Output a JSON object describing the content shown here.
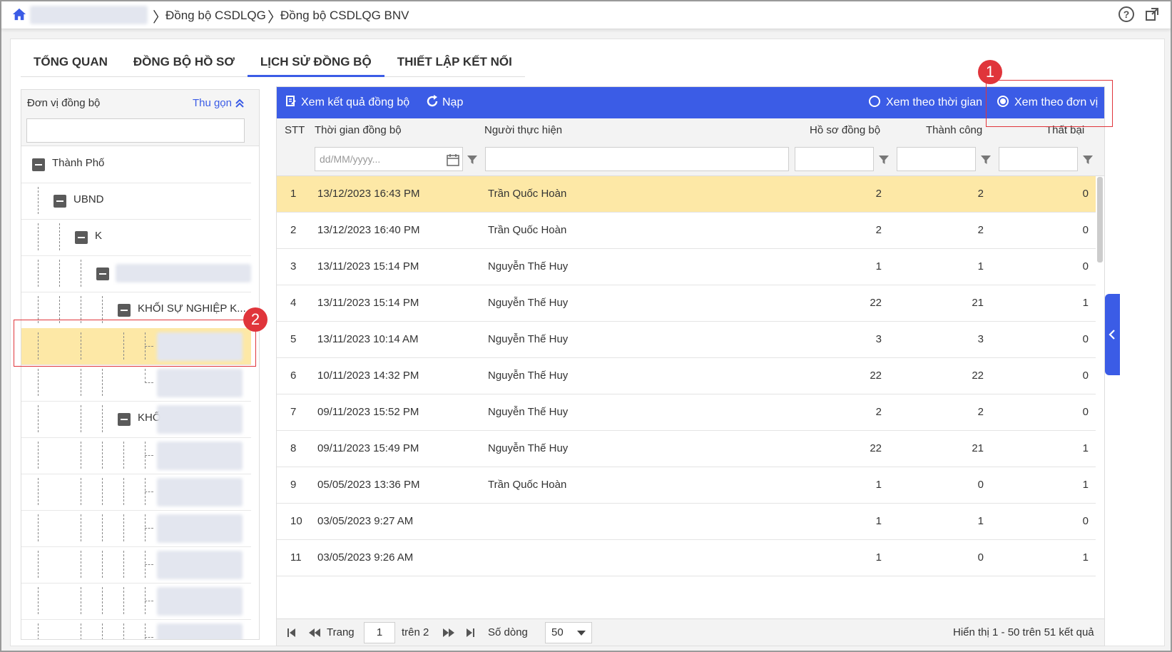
{
  "breadcrumb": {
    "items": [
      "Đồng bộ CSDLQG",
      "Đồng bộ CSDLQG BNV"
    ]
  },
  "help_glyph": "?",
  "tabs": [
    {
      "label": "TỔNG QUAN"
    },
    {
      "label": "ĐỒNG BỘ HỒ SƠ"
    },
    {
      "label": "LỊCH SỬ ĐỒNG BỘ",
      "active": true
    },
    {
      "label": "THIẾT LẬP KẾT NỐI"
    }
  ],
  "left_panel": {
    "title": "Đơn vị đồng bộ",
    "collapse_label": "Thu gọn",
    "tree": [
      "Thành Phố",
      "UBND",
      "K",
      "",
      "KHỐI SỰ NGHIỆP K...",
      "",
      "",
      "KHỐ",
      "",
      "",
      "",
      "",
      ""
    ]
  },
  "toolbar": {
    "view_result_label": "Xem kết quả đồng bộ",
    "reload_label": "Nạp",
    "view_by_time_label": "Xem theo thời gian",
    "view_by_unit_label": "Xem theo đơn vị",
    "selected_view": "Xem theo đơn vị"
  },
  "table": {
    "columns": [
      "STT",
      "Thời gian đồng bộ",
      "Người thực hiện",
      "Hồ sơ đồng bộ",
      "Thành công",
      "Thất bại"
    ],
    "date_placeholder": "dd/MM/yyyy...",
    "rows": [
      {
        "stt": "1",
        "time": "13/12/2023 16:43 PM",
        "user": "Trần Quốc Hoàn",
        "synced": "2",
        "success": "2",
        "failed": "0"
      },
      {
        "stt": "2",
        "time": "13/12/2023 16:40 PM",
        "user": "Trần Quốc Hoàn",
        "synced": "2",
        "success": "2",
        "failed": "0"
      },
      {
        "stt": "3",
        "time": "13/11/2023 15:14 PM",
        "user": "Nguyễn Thế Huy",
        "synced": "1",
        "success": "1",
        "failed": "0"
      },
      {
        "stt": "4",
        "time": "13/11/2023 15:14 PM",
        "user": "Nguyễn Thế Huy",
        "synced": "22",
        "success": "21",
        "failed": "1"
      },
      {
        "stt": "5",
        "time": "13/11/2023 10:14 AM",
        "user": "Nguyễn Thế Huy",
        "synced": "3",
        "success": "3",
        "failed": "0"
      },
      {
        "stt": "6",
        "time": "10/11/2023 14:32 PM",
        "user": "Nguyễn Thế Huy",
        "synced": "22",
        "success": "22",
        "failed": "0"
      },
      {
        "stt": "7",
        "time": "09/11/2023 15:52 PM",
        "user": "Nguyễn Thế Huy",
        "synced": "2",
        "success": "2",
        "failed": "0"
      },
      {
        "stt": "8",
        "time": "09/11/2023 15:49 PM",
        "user": "Nguyễn Thế Huy",
        "synced": "22",
        "success": "21",
        "failed": "1"
      },
      {
        "stt": "9",
        "time": "05/05/2023 13:36 PM",
        "user": "Trần Quốc Hoàn",
        "synced": "1",
        "success": "0",
        "failed": "1"
      },
      {
        "stt": "10",
        "time": "03/05/2023 9:27 AM",
        "user": "",
        "synced": "1",
        "success": "1",
        "failed": "0"
      },
      {
        "stt": "11",
        "time": "03/05/2023 9:26 AM",
        "user": "",
        "synced": "1",
        "success": "0",
        "failed": "1"
      }
    ]
  },
  "pager": {
    "page_label": "Trang",
    "page_value": "1",
    "of_label": "trên 2",
    "rows_label": "Số dòng",
    "rows_value": "50",
    "summary": "Hiển thị 1 - 50 trên 51 kết quả"
  },
  "annotations": {
    "badge_1": "1",
    "badge_2": "2"
  },
  "colors": {
    "accent": "#3b5ce6",
    "selected_row": "#fde8a6",
    "annotation": "#e0353b"
  }
}
